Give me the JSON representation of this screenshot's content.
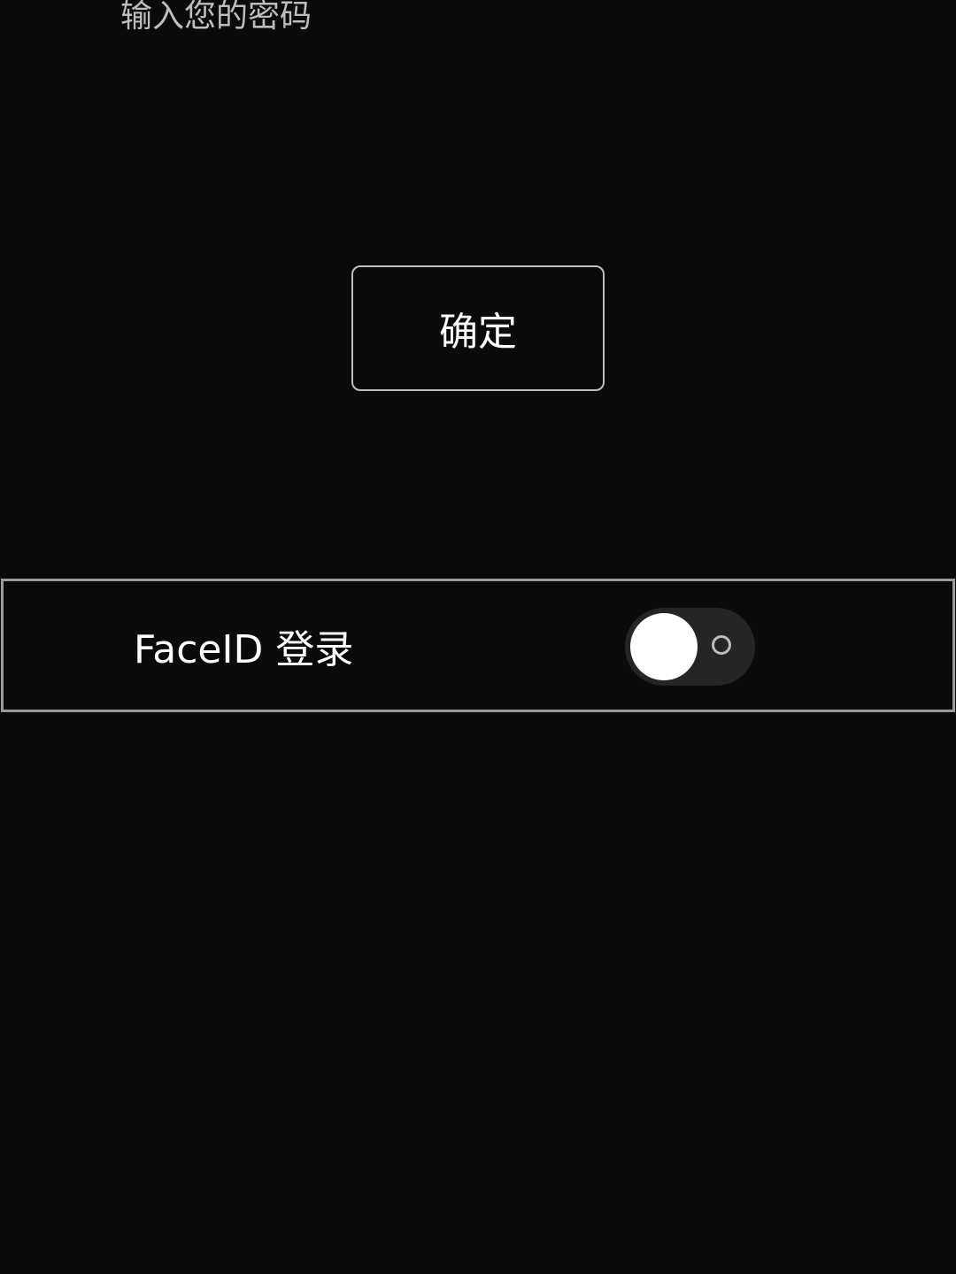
{
  "password": {
    "placeholder": "输入您的密码",
    "value": ""
  },
  "confirm": {
    "label": "确定"
  },
  "faceid": {
    "label": "FaceID 登录",
    "enabled": false
  },
  "colors": {
    "background": "#0b0b0b",
    "border": "#bdbdbd",
    "toggle_track": "#252527",
    "toggle_knob": "#ffffff"
  }
}
